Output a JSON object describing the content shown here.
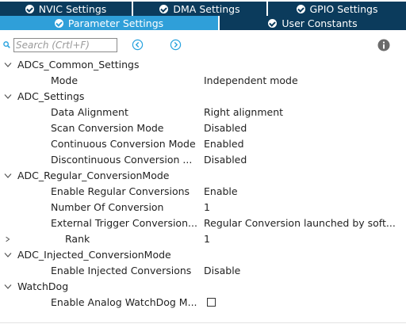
{
  "top_tabs": [
    {
      "label": "NVIC Settings",
      "icon": "check-circle-icon"
    },
    {
      "label": "DMA Settings",
      "icon": "check-circle-icon"
    },
    {
      "label": "GPIO Settings",
      "icon": "check-circle-icon"
    }
  ],
  "second_tabs": [
    {
      "label": "Parameter Settings",
      "icon": "check-circle-icon",
      "active": true
    },
    {
      "label": "User Constants",
      "icon": "check-circle-icon",
      "active": false
    }
  ],
  "toolbar": {
    "search_placeholder": "Search (Crtl+F)",
    "icons": [
      "search-icon",
      "previous-icon",
      "next-icon",
      "info-icon"
    ]
  },
  "tree": {
    "adcs_common": {
      "label": "ADCs_Common_Settings",
      "mode": {
        "label": "Mode",
        "value": "Independent mode"
      }
    },
    "adc_settings": {
      "label": "ADC_Settings",
      "data_alignment": {
        "label": "Data Alignment",
        "value": "Right alignment"
      },
      "scan_mode": {
        "label": "Scan Conversion Mode",
        "value": "Disabled"
      },
      "continuous_mode": {
        "label": "Continuous Conversion Mode",
        "value": "Enabled"
      },
      "discontinuous_mode": {
        "label": "Discontinuous Conversion ...",
        "value": "Disabled"
      }
    },
    "adc_regular": {
      "label": "ADC_Regular_ConversionMode",
      "enable_regular": {
        "label": "Enable Regular Conversions",
        "value": "Enable"
      },
      "number_of_conversion": {
        "label": "Number Of Conversion",
        "value": "1"
      },
      "external_trigger": {
        "label": "External Trigger Conversion...",
        "value": "Regular Conversion launched by soft..."
      },
      "rank": {
        "label": "Rank",
        "value": "1"
      }
    },
    "adc_injected": {
      "label": "ADC_Injected_ConversionMode",
      "enable_injected": {
        "label": "Enable Injected Conversions",
        "value": "Disable"
      }
    },
    "watchdog": {
      "label": "WatchDog",
      "enable_analog_watchdog": {
        "label": "Enable Analog WatchDog M...",
        "checked": false
      }
    }
  },
  "colors": {
    "tab_dark": "#0b3b5c",
    "tab_active": "#2f9fd9",
    "nav_accent": "#29a3df"
  }
}
